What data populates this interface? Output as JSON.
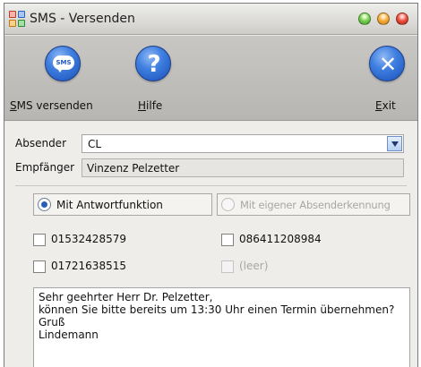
{
  "window": {
    "title": "SMS - Versenden"
  },
  "toolbar": {
    "send": {
      "label_u": "S",
      "label_rest": "MS versenden",
      "icon": "sms-bubble-icon",
      "icon_text": "SMS"
    },
    "help": {
      "label_u": "H",
      "label_rest": "ilfe",
      "icon": "question-icon",
      "icon_text": "?"
    },
    "exit": {
      "label_u": "E",
      "label_rest": "xit",
      "icon": "close-icon",
      "icon_text": "✕"
    }
  },
  "form": {
    "sender_label": "Absender",
    "sender_value": "CL",
    "recipient_label": "Empfänger",
    "recipient_value": "Vinzenz Pelzetter"
  },
  "options": {
    "with_reply": {
      "label": "Mit Antwortfunktion",
      "selected": true
    },
    "own_sender_id": {
      "label": "Mit eigener Absenderkennung",
      "selected": false,
      "disabled": true
    }
  },
  "numbers": [
    {
      "label": "01532428579",
      "checked": false,
      "disabled": false
    },
    {
      "label": "086411208984",
      "checked": false,
      "disabled": false
    },
    {
      "label": "01721638515",
      "checked": false,
      "disabled": false
    },
    {
      "label": "(leer)",
      "checked": false,
      "disabled": true
    }
  ],
  "message": {
    "lines": [
      "Sehr geehrter Herr Dr. Pelzetter,",
      "können Sie bitte bereits um 13:30 Uhr einen Termin übernehmen?",
      "Gruß",
      "Lindemann"
    ]
  },
  "colors": {
    "accent_blue": "#2a5fb9",
    "toolbar_bg": "#c1bfbb",
    "window_bg": "#efedea"
  }
}
